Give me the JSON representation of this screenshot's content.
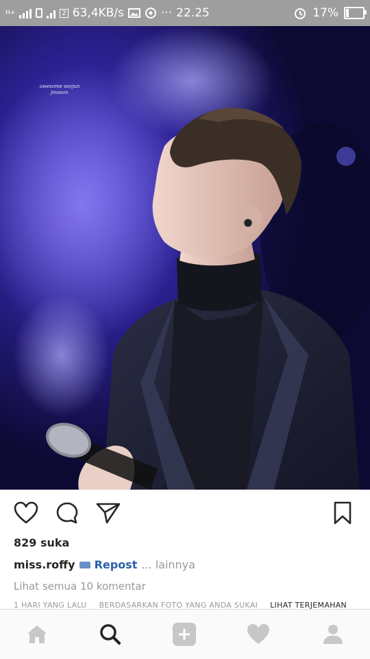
{
  "status_bar": {
    "network": "H+",
    "sim": "2",
    "speed": "63,4KB/s",
    "overflow": "···",
    "time": "22.25",
    "battery": "17%",
    "battery_level": 0.17
  },
  "post": {
    "watermark_line1": "awesome seojun",
    "watermark_line2": "jinseon",
    "likes": "829 suka",
    "username": "miss.roffy",
    "caption": "Repost",
    "more": "... lainnya",
    "view_comments": "Lihat semua 10 komentar",
    "time_ago": "1 HARI YANG LALU",
    "recommendation": "BERDASARKAN FOTO YANG ANDA SUKAI",
    "translate": "LIHAT TERJEMAHAN"
  },
  "icons": {
    "like": "heart-icon",
    "comment": "comment-icon",
    "share": "send-icon",
    "save": "bookmark-icon"
  },
  "bottom_nav": [
    "home-icon",
    "search-icon",
    "add-icon",
    "activity-icon",
    "profile-icon"
  ],
  "colors": {
    "status_bar": "#9e9e9e",
    "text_primary": "#262626",
    "text_secondary": "#999999",
    "nav_inactive": "#c7c7c7",
    "nav_active": "#262626"
  }
}
